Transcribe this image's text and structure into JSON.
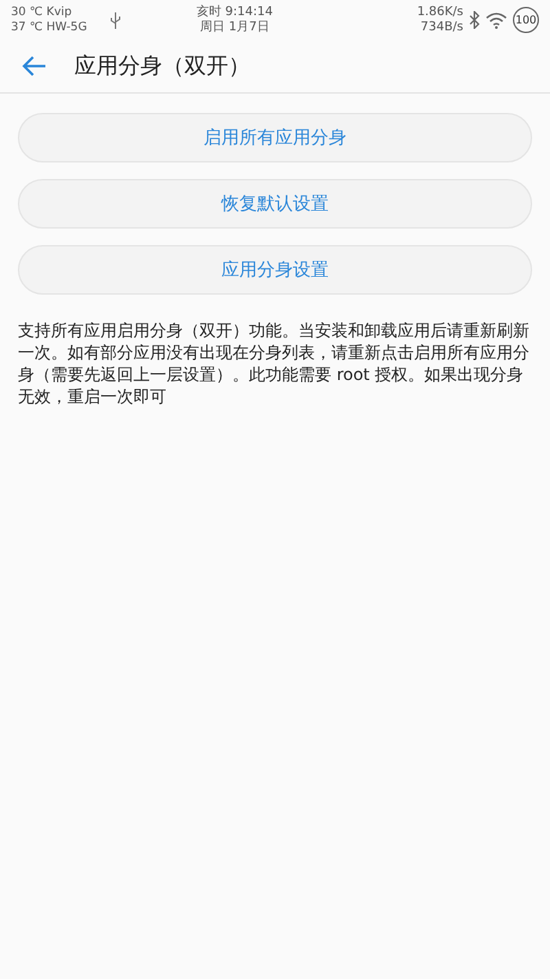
{
  "status_bar": {
    "left": [
      "30 ℃ Kvip",
      "37 ℃ HW-5G"
    ],
    "center": [
      "亥时 9:14:14",
      "周日 1月7日"
    ],
    "right": [
      "1.86K/s",
      "734B/s"
    ],
    "battery": "100"
  },
  "header": {
    "title": "应用分身（双开）"
  },
  "buttons": [
    "启用所有应用分身",
    "恢复默认设置",
    "应用分身设置"
  ],
  "description": "支持所有应用启用分身（双开）功能。当安装和卸载应用后请重新刷新一次。如有部分应用没有出现在分身列表，请重新点击启用所有应用分身（需要先返回上一层设置）。此功能需要 root 授权。如果出现分身无效，重启一次即可"
}
